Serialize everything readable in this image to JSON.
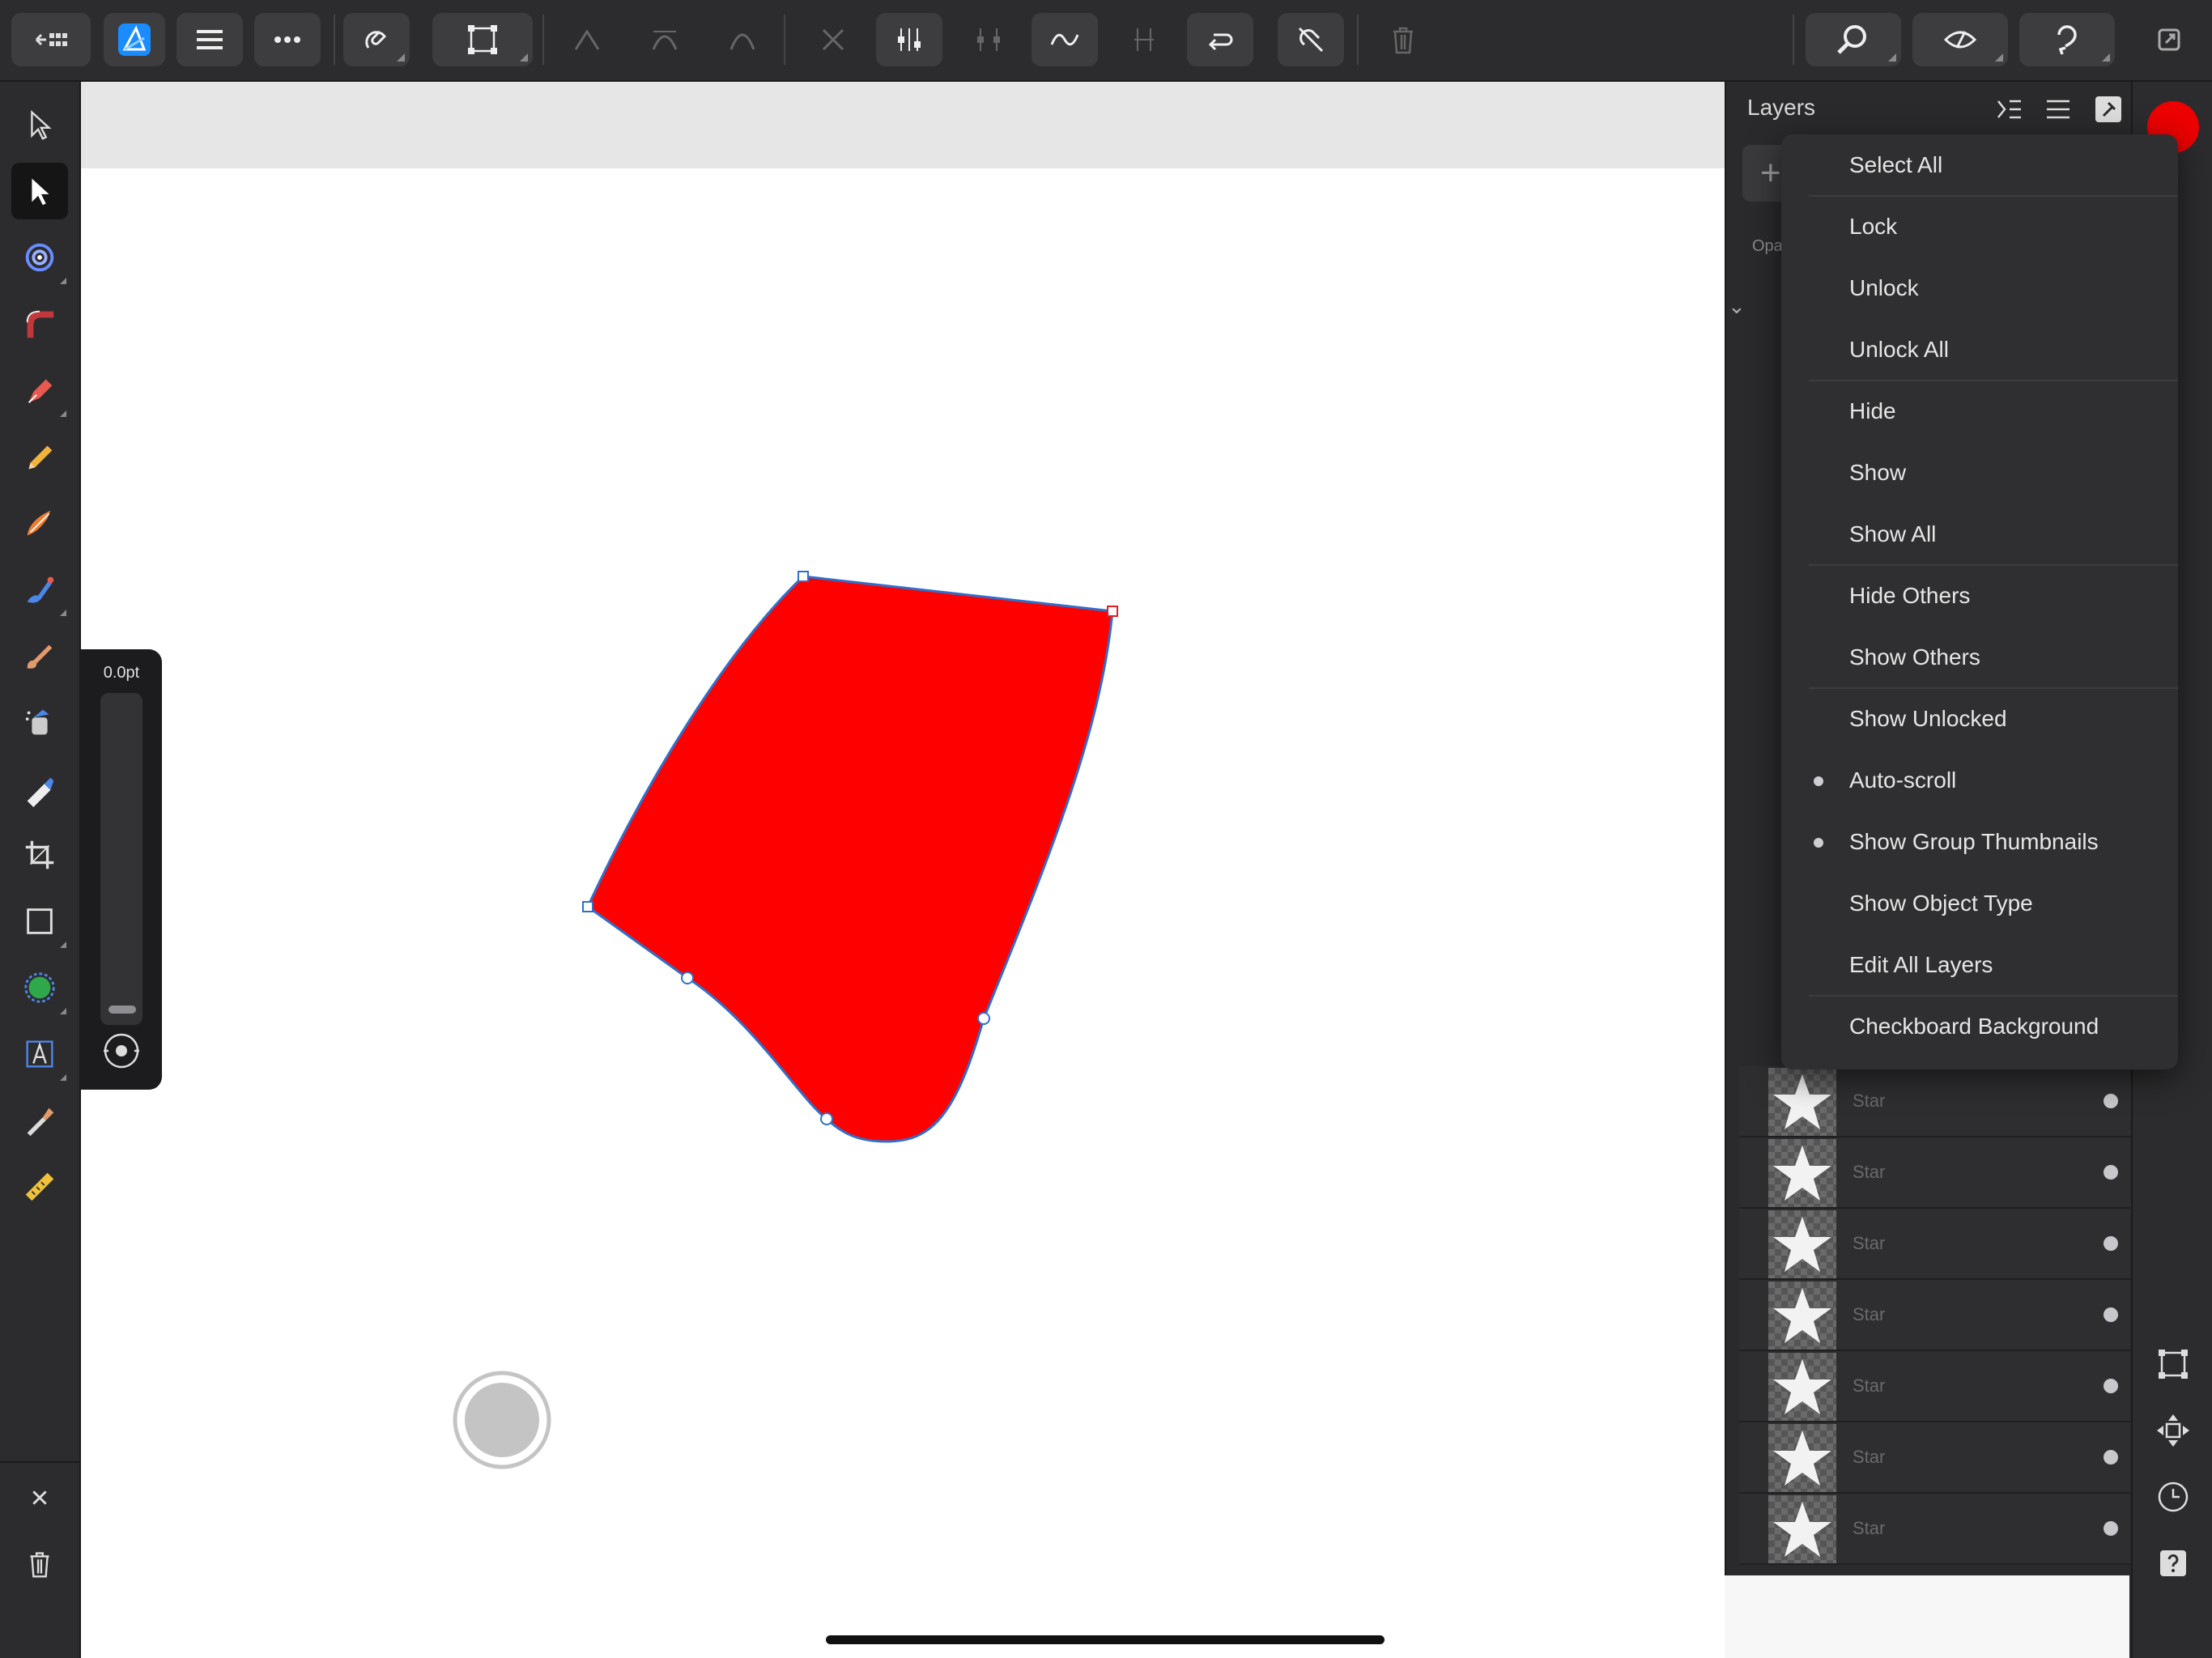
{
  "toolbar": {
    "back_label": "←",
    "buttons": [
      "documents-icon",
      "affinity-designer-icon",
      "menu-icon",
      "more-icon",
      "snapping-icon",
      "transform-icon",
      "sharp-node-icon",
      "smooth-node-icon",
      "smart-node-icon",
      "break-curve-icon",
      "align-nodes-icon",
      "align-nodes-vertical-icon",
      "convert-curve-icon",
      "distribute-nodes-icon",
      "close-curve-icon",
      "remove-node-icon",
      "delete-icon",
      "view-icon",
      "preview-icon",
      "undo-redo-icon",
      "fullscreen-icon"
    ]
  },
  "width_slider": {
    "value": "0.0pt"
  },
  "layers_panel": {
    "title": "Layers",
    "add_label": "+",
    "opacity_label": "Opa",
    "expand_glyph": "⌄",
    "rows": [
      {
        "name": "Star"
      },
      {
        "name": "Star"
      },
      {
        "name": "Star"
      },
      {
        "name": "Star"
      },
      {
        "name": "Star"
      },
      {
        "name": "Star"
      },
      {
        "name": "Star"
      }
    ]
  },
  "menu": {
    "items": [
      {
        "label": "Select All",
        "checked": false
      },
      {
        "label": "Lock",
        "checked": false
      },
      {
        "label": "Unlock",
        "checked": false
      },
      {
        "label": "Unlock All",
        "checked": false
      },
      {
        "label": "Hide",
        "checked": false
      },
      {
        "label": "Show",
        "checked": false
      },
      {
        "label": "Show All",
        "checked": false
      },
      {
        "label": "Hide Others",
        "checked": false
      },
      {
        "label": "Show Others",
        "checked": false
      },
      {
        "label": "Show Unlocked",
        "checked": false
      },
      {
        "label": "Auto-scroll",
        "checked": true
      },
      {
        "label": "Show Group Thumbnails",
        "checked": true
      },
      {
        "label": "Show Object Type",
        "checked": false
      },
      {
        "label": "Edit All Layers",
        "checked": false
      },
      {
        "label": "Checkboard Background",
        "checked": false
      }
    ]
  },
  "colors": {
    "shape_fill": "#ff0000",
    "shape_stroke": "#2f6fc9",
    "accent": "#0a84ff"
  },
  "tools": [
    "move-tool-icon",
    "node-tool-icon",
    "point-transform-icon",
    "corner-tool-icon",
    "pen-tool-icon",
    "pencil-tool-icon",
    "vector-brush-icon",
    "fill-tool-icon",
    "brush-icon",
    "spray-icon",
    "transparency-tool-icon",
    "crop-icon",
    "rectangle-tool-icon",
    "shape-tool-icon",
    "text-tool-icon",
    "color-picker-icon",
    "measure-tool-icon"
  ]
}
